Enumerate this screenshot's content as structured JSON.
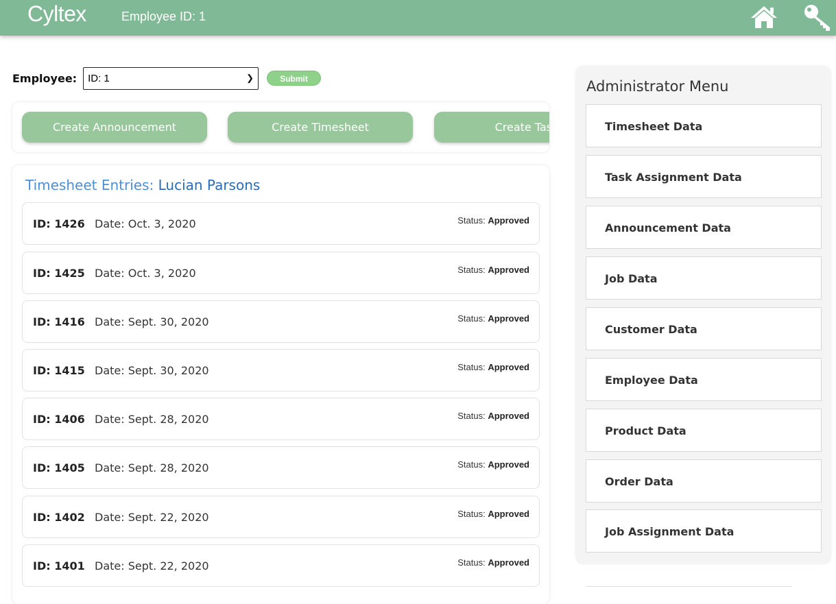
{
  "header": {
    "brand": "Cyltex",
    "employee_id_label": "Employee ID: 1",
    "background_color": "#80b996",
    "icons": [
      "home-icon",
      "key-icon"
    ]
  },
  "employee_select": {
    "label": "Employee:",
    "selected": "ID: 1",
    "submit_label": "Submit"
  },
  "actions": [
    {
      "label": "Create Announcement"
    },
    {
      "label": "Create Timesheet"
    },
    {
      "label": "Create Task"
    }
  ],
  "timesheet": {
    "title_prefix": "Timesheet Entries:",
    "employee_name": "Lucian Parsons",
    "status_label": "Status:",
    "entries": [
      {
        "id": "ID: 1426",
        "date": "Date: Oct. 3, 2020",
        "status": "Approved"
      },
      {
        "id": "ID: 1425",
        "date": "Date: Oct. 3, 2020",
        "status": "Approved"
      },
      {
        "id": "ID: 1416",
        "date": "Date: Sept. 30, 2020",
        "status": "Approved"
      },
      {
        "id": "ID: 1415",
        "date": "Date: Sept. 30, 2020",
        "status": "Approved"
      },
      {
        "id": "ID: 1406",
        "date": "Date: Sept. 28, 2020",
        "status": "Approved"
      },
      {
        "id": "ID: 1405",
        "date": "Date: Sept. 28, 2020",
        "status": "Approved"
      },
      {
        "id": "ID: 1402",
        "date": "Date: Sept. 22, 2020",
        "status": "Approved"
      },
      {
        "id": "ID: 1401",
        "date": "Date: Sept. 22, 2020",
        "status": "Approved"
      }
    ]
  },
  "admin_menu": {
    "title": "Administrator Menu",
    "items": [
      {
        "label": "Timesheet Data"
      },
      {
        "label": "Task Assignment Data"
      },
      {
        "label": "Announcement Data"
      },
      {
        "label": "Job Data"
      },
      {
        "label": "Customer Data"
      },
      {
        "label": "Employee Data"
      },
      {
        "label": "Product Data"
      },
      {
        "label": "Order Data"
      },
      {
        "label": "Job Assignment Data"
      }
    ]
  }
}
